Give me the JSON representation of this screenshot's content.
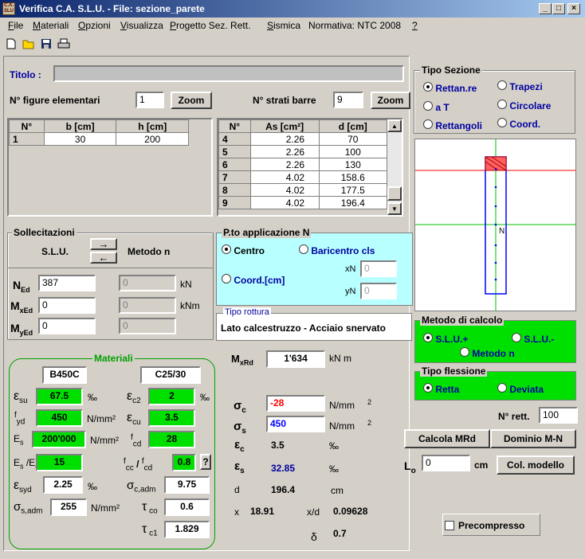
{
  "window": {
    "title": "Verifica C.A. S.L.U. - File: sezione_parete",
    "icon_text": "C.A.\nSLU",
    "min_glyph": "_",
    "max_glyph": "□",
    "close_glyph": "×"
  },
  "menu": [
    {
      "label": "File",
      "u": "F",
      "rest": "ile"
    },
    {
      "label": "Materiali",
      "u": "M",
      "rest": "ateriali"
    },
    {
      "label": "Opzioni",
      "u": "O",
      "rest": "pzioni"
    },
    {
      "label": "Visualizza",
      "u": "V",
      "rest": "isualizza"
    },
    {
      "label": "Progetto Sez. Rett.",
      "u": "P",
      "rest": "rogetto Sez. Rett."
    },
    {
      "label": "Sismica",
      "u": "S",
      "rest": "ismica"
    },
    {
      "label": "Normativa: NTC 2008",
      "u": "",
      "rest": "Normativa: NTC 2008"
    },
    {
      "label": "?",
      "u": "?",
      "rest": ""
    }
  ],
  "toolbar": {
    "icons": [
      "new-file-icon",
      "open-folder-icon",
      "save-disk-icon",
      "print-icon"
    ]
  },
  "titolo": {
    "label": "Titolo :",
    "value": ""
  },
  "figure": {
    "label": "N° figure elementari",
    "count": "1",
    "zoom": "Zoom",
    "columns": [
      "N°",
      "b [cm]",
      "h [cm]"
    ],
    "rows": [
      [
        "1",
        "30",
        "200"
      ]
    ]
  },
  "strati": {
    "label": "N° strati barre",
    "count": "9",
    "zoom": "Zoom",
    "columns": [
      "N°",
      "As [cm²]",
      "d [cm]"
    ],
    "rows": [
      [
        "4",
        "2.26",
        "70"
      ],
      [
        "5",
        "2.26",
        "100"
      ],
      [
        "6",
        "2.26",
        "130"
      ],
      [
        "7",
        "4.02",
        "158.6"
      ],
      [
        "8",
        "4.02",
        "177.5"
      ],
      [
        "9",
        "4.02",
        "196.4"
      ]
    ]
  },
  "tipo_sezione": {
    "title": "Tipo Sezione",
    "options": [
      "Rettan.re",
      "Trapezi",
      "a T",
      "Circolare",
      "Rettangoli",
      "Coord."
    ],
    "selected": "Rettan.re"
  },
  "preview": {
    "label_n": "N",
    "colors": {
      "axis_green": "#00c000",
      "axis_red": "#ff0000",
      "section_blue": "#0000ff"
    }
  },
  "sollecitazioni": {
    "title": "Sollecitazioni",
    "slu": "S.L.U.",
    "metodo": "Metodo n",
    "arrow_right": "→",
    "arrow_left": "←",
    "n_label": "N",
    "n_sub": "Ed",
    "mx_label": "M",
    "mx_sub": "xEd",
    "my_label": "M",
    "my_sub": "yEd",
    "slu_values": [
      "387",
      "0",
      "0"
    ],
    "metodo_values": [
      "0",
      "0",
      "0"
    ],
    "units": [
      "kN",
      "kNm"
    ]
  },
  "applicazione": {
    "title": "P.to applicazione N",
    "options": [
      "Centro",
      "Baricentro cls",
      "Coord.[cm]"
    ],
    "selected": "Centro",
    "xn_label": "xN",
    "yn_label": "yN",
    "xn": "0",
    "yn": "0"
  },
  "rottura": {
    "title": "Tipo rottura",
    "value": "Lato calcestruzzo - Acciaio snervato"
  },
  "metodo_calcolo": {
    "title": "Metodo di calcolo",
    "options": [
      "S.L.U.+",
      "S.L.U.-",
      "Metodo n"
    ],
    "selected": "S.L.U.+"
  },
  "tipo_flessione": {
    "title": "Tipo flessione",
    "options": [
      "Retta",
      "Deviata"
    ],
    "selected": "Retta"
  },
  "materiali": {
    "title": "Materiali",
    "steel": "B450C",
    "concrete": "C25/30",
    "esu": "67.5",
    "esu_unit": "‰",
    "ec2": "2",
    "ec2_unit": "‰",
    "fyd": "450",
    "fyd_unit": "N/mm²",
    "ecu": "3.5",
    "es": "200'000",
    "es_unit": "N/mm²",
    "fcd": "28",
    "es_ec": "15",
    "fcc_fcd": "0.8",
    "help": "?",
    "esyd": "2.25",
    "esyd_unit": "‰",
    "sigma_cadm": "9.75",
    "sigma_sadm": "255",
    "sigma_sadm_unit": "N/mm²",
    "tau_co": "0.6",
    "tau_c1": "1.829"
  },
  "risultati": {
    "mxrd_label": "M",
    "mxrd_sub": "xRd",
    "mxrd": "1'634",
    "mxrd_unit": "kN m",
    "sigma_c": "-28",
    "sigma_s": "450",
    "unit_nmm": "N/mm",
    "sup2": "2",
    "eps_c": "3.5",
    "eps_s": "32.85",
    "permil": "‰",
    "d_label": "d",
    "d": "196.4",
    "cm": "cm",
    "x_label": "x",
    "x": "18.91",
    "xd_label": "x/d",
    "xd": "0.09628",
    "delta_label": "δ",
    "delta": "0.7"
  },
  "right_controls": {
    "nrett_label": "N° rett.",
    "nrett": "100",
    "calcola": "Calcola MRd",
    "dominio": "Dominio M-N",
    "lo_label": "L",
    "lo_sub": "o",
    "lo": "0",
    "lo_unit": "cm",
    "col_modello": "Col. modello",
    "precompresso": "Precompresso"
  }
}
